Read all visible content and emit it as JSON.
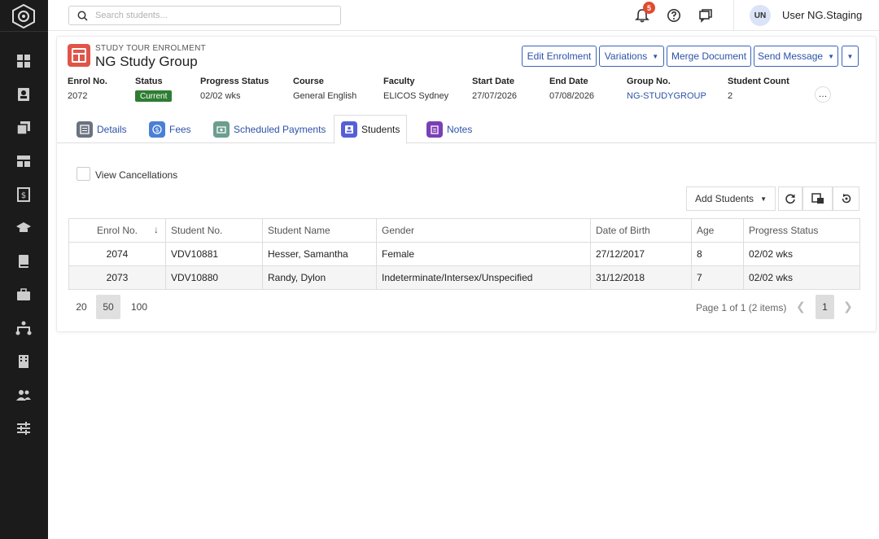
{
  "topbar": {
    "search_placeholder": "Search students...",
    "notifications_count": "5",
    "user_initials": "UN",
    "user_name": "User NG.Staging"
  },
  "header": {
    "subtitle": "STUDY TOUR ENROLMENT",
    "title": "NG Study Group",
    "buttons": {
      "edit_enrolment": "Edit Enrolment",
      "variations": "Variations",
      "merge_document": "Merge Document",
      "send_message": "Send Message"
    }
  },
  "meta": {
    "enrol_no_label": "Enrol No.",
    "enrol_no": "2072",
    "status_label": "Status",
    "status": "Current",
    "progress_label": "Progress Status",
    "progress": "02/02 wks",
    "course_label": "Course",
    "course": "General English",
    "faculty_label": "Faculty",
    "faculty": "ELICOS Sydney",
    "start_label": "Start Date",
    "start": "27/07/2026",
    "end_label": "End Date",
    "end": "07/08/2026",
    "group_label": "Group No.",
    "group": "NG-STUDYGROUP",
    "count_label": "Student Count",
    "count": "2",
    "more": "…"
  },
  "tabs": [
    {
      "label": "Details",
      "color": "#6b7280"
    },
    {
      "label": "Fees",
      "color": "#4a7fd6"
    },
    {
      "label": "Scheduled Payments",
      "color": "#6b9e8f"
    },
    {
      "label": "Students",
      "color": "#5560d6"
    },
    {
      "label": "Notes",
      "color": "#7b3fb5"
    }
  ],
  "filters": {
    "view_cancellations": "View Cancellations",
    "add_students": "Add Students"
  },
  "table": {
    "columns": [
      "Enrol No.",
      "Student No.",
      "Student Name",
      "Gender",
      "Date of Birth",
      "Age",
      "Progress Status"
    ],
    "rows": [
      [
        "2074",
        "VDV10881",
        "Hesser, Samantha",
        "Female",
        "27/12/2017",
        "8",
        "02/02 wks"
      ],
      [
        "2073",
        "VDV10880",
        "Randy, Dylon",
        "Indeterminate/Intersex/Unspecified",
        "31/12/2018",
        "7",
        "02/02 wks"
      ]
    ]
  },
  "pager": {
    "sizes": [
      "20",
      "50",
      "100"
    ],
    "info": "Page 1 of 1 (2 items)",
    "current_page": "1"
  }
}
